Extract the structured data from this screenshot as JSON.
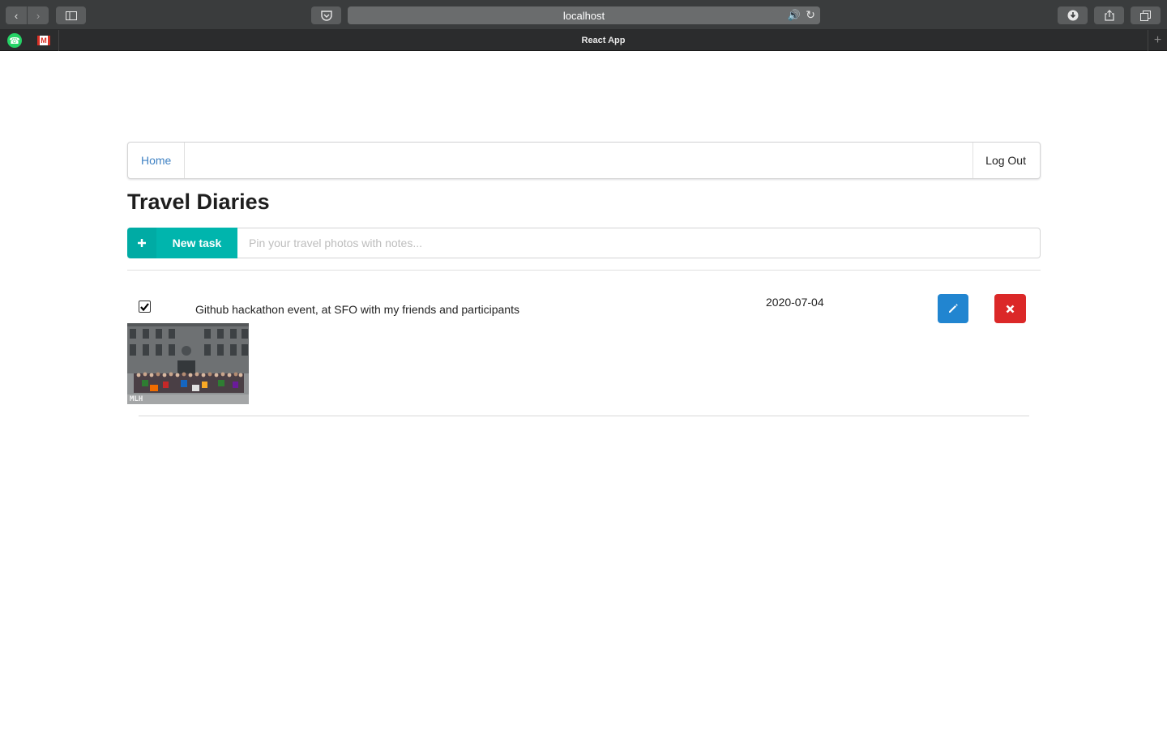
{
  "browser": {
    "url": "localhost",
    "active_tab_title": "React App",
    "pinned_tabs": [
      "whatsapp",
      "gmail"
    ]
  },
  "menu": {
    "home_label": "Home",
    "logout_label": "Log Out"
  },
  "page": {
    "title": "Travel Diaries"
  },
  "new_task": {
    "button_label": "New task",
    "input_placeholder": "Pin your travel photos with notes...",
    "input_value": ""
  },
  "tasks": [
    {
      "checked": true,
      "text": "Github hackathon event, at SFO with my friends and participants",
      "date": "2020-07-04",
      "photo_watermark": "MLH"
    }
  ],
  "colors": {
    "teal": "#00b5ad",
    "blue": "#2185d0",
    "red": "#db2828",
    "link": "#4183c4"
  },
  "icons": {
    "plus": "plus-icon",
    "edit": "pencil-icon",
    "delete": "close-icon"
  }
}
